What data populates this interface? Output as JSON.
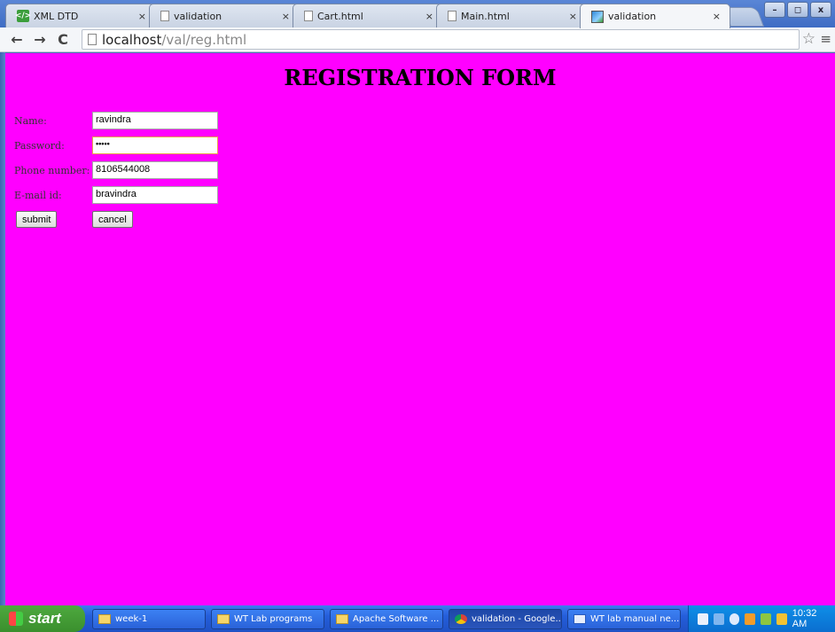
{
  "browser": {
    "tabs": [
      {
        "title": "XML DTD",
        "icon": "xml-icon"
      },
      {
        "title": "validation",
        "icon": "page-icon"
      },
      {
        "title": "Cart.html",
        "icon": "page-icon"
      },
      {
        "title": "Main.html",
        "icon": "page-icon"
      },
      {
        "title": "validation",
        "icon": "image-icon",
        "active": true
      }
    ],
    "tab_close": "×",
    "nav": {
      "back": "←",
      "forward": "→",
      "reload": "C"
    },
    "address": {
      "host": "localhost",
      "path": "/val/reg.html"
    },
    "star": "☆",
    "menu": "≡",
    "window_buttons": {
      "minimize": "–",
      "maximize": "◻",
      "close": "x"
    }
  },
  "page": {
    "background": "#ff00ff",
    "heading": "REGISTRATION FORM",
    "fields": [
      {
        "label": "Name:",
        "value": "ravindra"
      },
      {
        "label": "Password:",
        "value": "•••••"
      },
      {
        "label": "Phone number:",
        "value": "8106544008"
      },
      {
        "label": "E-mail id:",
        "value": "bravindra"
      }
    ],
    "buttons": {
      "submit": "submit",
      "cancel": "cancel"
    }
  },
  "taskbar": {
    "start": "start",
    "tasks": [
      {
        "label": "week-1",
        "icon": "folder-icon"
      },
      {
        "label": "WT Lab programs",
        "icon": "folder-icon"
      },
      {
        "label": "Apache Software ...",
        "icon": "folder-icon"
      },
      {
        "label": "validation - Google...",
        "icon": "chrome-icon",
        "active": true
      },
      {
        "label": "WT lab manual ne...",
        "icon": "document-icon"
      }
    ],
    "clock": "10:32 AM"
  }
}
